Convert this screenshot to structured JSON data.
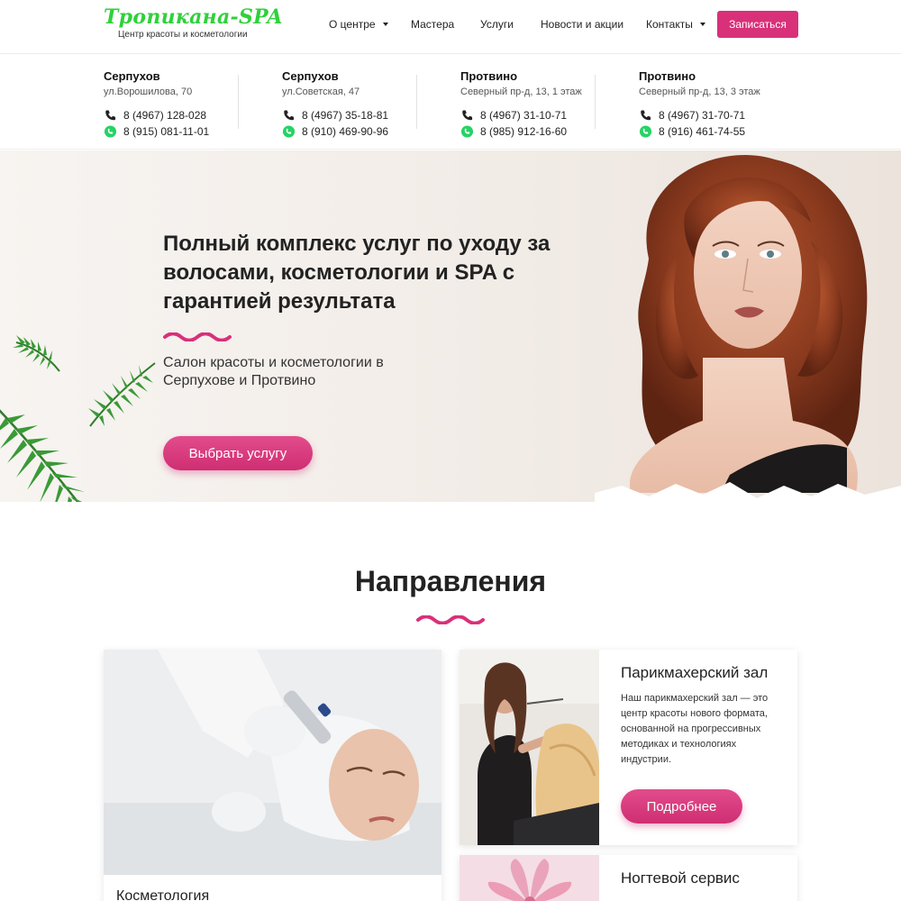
{
  "header": {
    "logo_title": "Тропикана-SPA",
    "logo_subtitle": "Центр красоты и косметологии",
    "nav": [
      "О центре",
      "Мастера",
      "Услуги",
      "Новости и акции",
      "Контакты"
    ],
    "book_button": "Записаться"
  },
  "branches": [
    {
      "city": "Серпухов",
      "address": "ул.Ворошилова, 70",
      "phone": "8 (4967) 128-028",
      "whatsapp": "8 (915) 081-11-01"
    },
    {
      "city": "Серпухов",
      "address": "ул.Советская, 47",
      "phone": "8 (4967) 35-18-81",
      "whatsapp": "8 (910) 469-90-96"
    },
    {
      "city": "Протвино",
      "address": "Северный пр-д, 13, 1 этаж",
      "phone": "8 (4967) 31-10-71",
      "whatsapp": "8 (985) 912-16-60"
    },
    {
      "city": "Протвино",
      "address": "Северный пр-д, 13, 3 этаж",
      "phone": "8 (4967) 31-70-71",
      "whatsapp": "8 (916) 461-74-55"
    }
  ],
  "hero": {
    "title": "Полный комплекс услуг по уходу за волосами, косметологии и SPA с гарантией результата",
    "subtitle": "Салон красоты и косметологии в Серпухове и Протвино",
    "button": "Выбрать услугу"
  },
  "directions": {
    "title": "Направления",
    "big_card_title": "Косметология",
    "hair": {
      "title": "Парикмахерский зал",
      "text": "Наш парикмахерский зал — это центр красоты нового формата, основанной на прогрессивных методиках и технологиях индустрии.",
      "button": "Подробнее"
    },
    "nails": {
      "title": "Ногтевой сервис"
    }
  },
  "colors": {
    "accent": "#d9307a",
    "logo_green": "#2fd13a",
    "whatsapp": "#25d366"
  }
}
